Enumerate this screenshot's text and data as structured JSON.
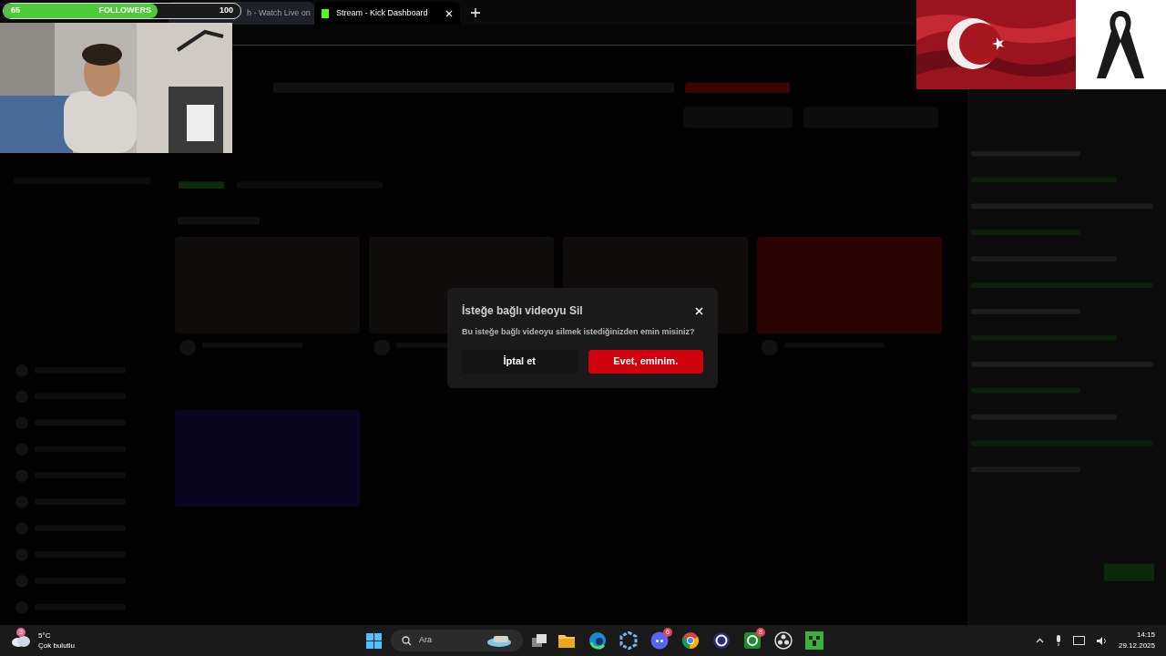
{
  "followers_goal": {
    "current": "65",
    "label": "FOLLOWERS",
    "target": "100",
    "level": 0.65
  },
  "browser_tabs": [
    {
      "title": "h - Watch Live on",
      "selected": false
    },
    {
      "title": "Stream - Kick Dashboard",
      "selected": true
    }
  ],
  "dialog": {
    "title": "İsteğe bağlı videoyu Sil",
    "message": "Bu isteğe bağlı videoyu silmek istediğinizden emin misiniz?",
    "cancel": "İptal et",
    "confirm": "Evet, eminim."
  },
  "taskbar": {
    "weather": {
      "badge": "3",
      "temperature": "5°C",
      "condition": "Çok bulutlu"
    },
    "search_placeholder": "Ara",
    "apps": [
      {
        "kind": "explorer"
      },
      {
        "kind": "edge"
      },
      {
        "kind": "hub"
      },
      {
        "kind": "discord",
        "badge": "6"
      },
      {
        "kind": "chrome"
      },
      {
        "kind": "ring"
      },
      {
        "kind": "xbox",
        "badge": "8"
      },
      {
        "kind": "obs"
      },
      {
        "kind": "minecraft"
      }
    ],
    "time": "14:15",
    "date": "29.12.2025"
  }
}
